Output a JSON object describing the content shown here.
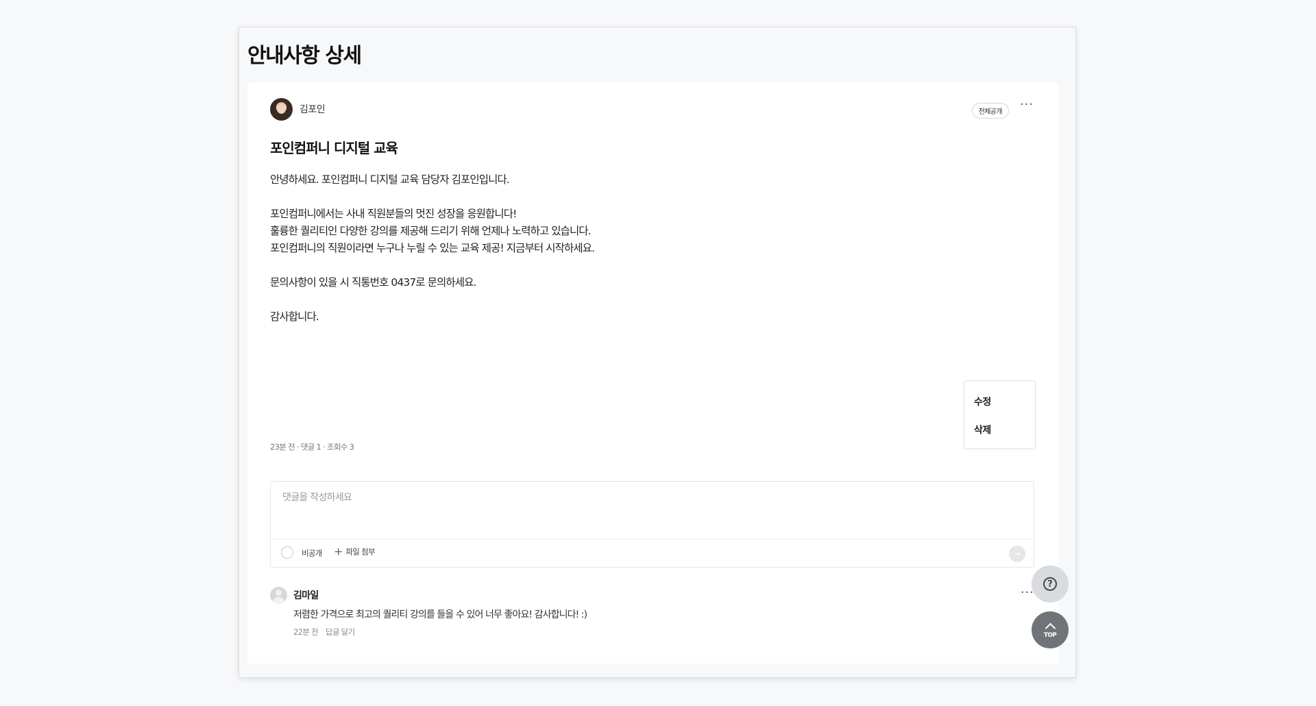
{
  "page": {
    "title": "안내사항 상세"
  },
  "post": {
    "author": "김포인",
    "visibility": "전체공개",
    "more_label": "···",
    "title": "포인컴퍼니 디지털 교육",
    "body_lines": [
      "안녕하세요. 포인컴퍼니 디지털 교육 담당자 김포인입니다.",
      "",
      "포인컴퍼니에서는 사내 직원분들의 멋진 성장을 응원합니다!",
      "훌륭한 퀄리티인 다양한 강의를 제공해 드리기 위해 언제나 노력하고 있습니다.",
      "포인컴퍼니의 직원이라면 누구나 누릴 수 있는 교육 제공! 지금부터 시작하세요.",
      "",
      "문의사항이 있을 시 직통번호 0437로 문의하세요.",
      "",
      "감사합니다."
    ],
    "meta": "23분 전 · 댓글 1 · 조회수 3"
  },
  "context_menu": {
    "edit": "수정",
    "delete": "삭제"
  },
  "comment_form": {
    "placeholder": "댓글을 작성하세요",
    "private_label": "비공개",
    "attach_label": "파일 첨부",
    "send_symbol": "→"
  },
  "comments": [
    {
      "author": "김마일",
      "text": "저렴한 가격으로 최고의 퀄리티 강의를 들을 수 있어 너무 좋아요! 감사합니다! :)",
      "time": "22분 전",
      "reply_label": "답글 달기",
      "more_label": "···"
    }
  ],
  "floating": {
    "help_symbol": "?",
    "top_label": "TOP"
  },
  "icons": {
    "attach": "plus-icon",
    "help": "question-circle-icon",
    "top": "chevron-up-icon"
  }
}
